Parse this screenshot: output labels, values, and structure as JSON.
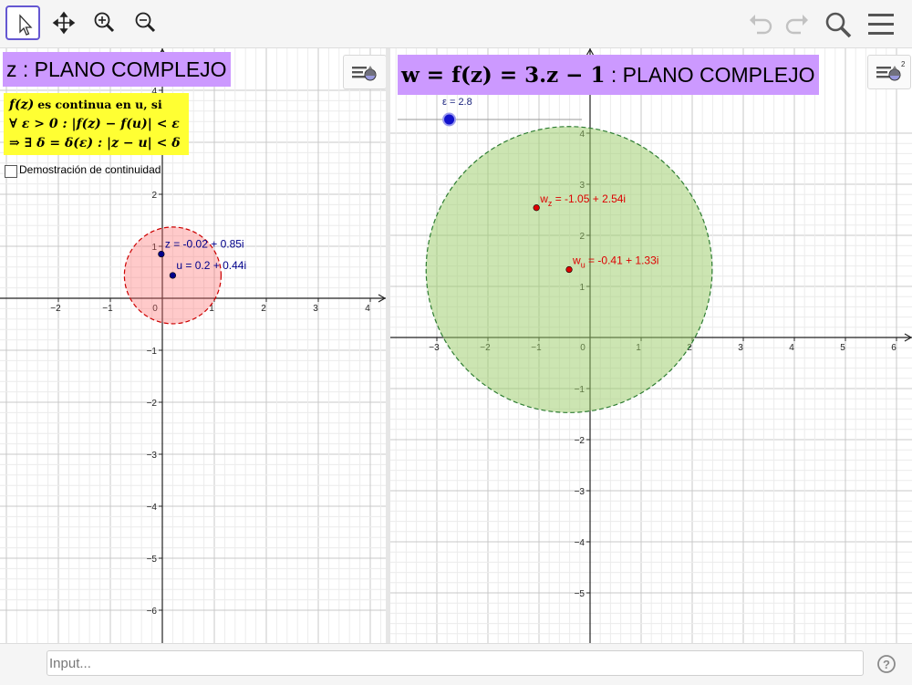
{
  "toolbar": {
    "tools": [
      {
        "name": "move-tool",
        "icon": "cursor-arrow-icon",
        "active": true
      },
      {
        "name": "move-graphics-view-tool",
        "icon": "four-way-arrows-icon"
      },
      {
        "name": "zoom-in-tool",
        "icon": "zoom-in-icon"
      },
      {
        "name": "zoom-out-tool",
        "icon": "zoom-out-icon"
      }
    ],
    "right_icons": [
      "undo-icon",
      "redo-icon",
      "search-icon",
      "menu-icon"
    ]
  },
  "left_view": {
    "title": "z : PLANO COMPLEJO",
    "definition": {
      "line1_math": "f(z)",
      "line1_text": "es continua en u, si",
      "line2": "∀ ε > 0 : |f(z) − f(u)| < ε",
      "line3": "⇒ ∃ δ = δ(ε) : |z − u| < δ"
    },
    "checkbox_label": "Demostración de continuidad",
    "checkbox_checked": false,
    "points": [
      {
        "label": "z = -0.02 + 0.85i",
        "re": -0.02,
        "im": 0.85,
        "color": "#00008b"
      },
      {
        "label": "u = 0.2 + 0.44i",
        "re": 0.2,
        "im": 0.44,
        "color": "#00008b"
      }
    ],
    "circle": {
      "center_re": 0.2,
      "center_im": 0.44,
      "radius": 0.93,
      "fill": "#ff6666",
      "stroke": "#cc0000"
    },
    "x_ticks": [
      "−2",
      "−1",
      "0",
      "1",
      "2",
      "3",
      "4"
    ],
    "y_ticks": [
      "4",
      "3",
      "2",
      "1",
      "−1",
      "−2",
      "−3",
      "−4",
      "−5",
      "−6"
    ]
  },
  "right_view": {
    "title_math": "w = f(z) = 3.z − 1",
    "title_text": ": PLANO COMPLEJO",
    "slider": {
      "label": "ε = 2.8",
      "value": 2.8,
      "min": 0,
      "max": 10
    },
    "points": [
      {
        "label": "w",
        "sub": "z",
        "value": " = -1.05 + 2.54i",
        "re": -1.05,
        "im": 2.54,
        "color": "#dd0000"
      },
      {
        "label": "w",
        "sub": "u",
        "value": " = -0.41 + 1.33i",
        "re": -0.41,
        "im": 1.33,
        "color": "#dd0000"
      }
    ],
    "circle": {
      "center_re": -0.41,
      "center_im": 1.33,
      "radius": 2.8,
      "fill": "#99cc66",
      "stroke": "#2e7d32"
    },
    "x_ticks": [
      "−3",
      "−2",
      "−1",
      "0",
      "1",
      "2",
      "3",
      "4",
      "5",
      "6"
    ],
    "y_ticks": [
      "4",
      "3",
      "2",
      "1",
      "−1",
      "−2",
      "−3",
      "−4",
      "−5"
    ]
  },
  "input": {
    "placeholder": "Input..."
  },
  "help_icon": "help-icon"
}
